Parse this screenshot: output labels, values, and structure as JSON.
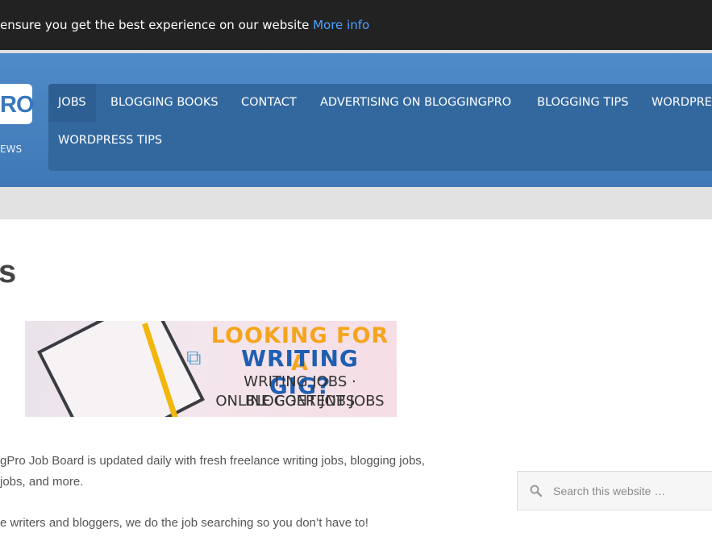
{
  "cookie_bar": {
    "text": "ensure you get the best experience on our website",
    "link": "More info"
  },
  "logo": {
    "text": "RO",
    "tagline": "EWS"
  },
  "nav": {
    "items": [
      {
        "label": "JOBS",
        "active": true
      },
      {
        "label": "BLOGGING BOOKS"
      },
      {
        "label": "CONTACT"
      },
      {
        "label": "ADVERTISING ON BLOGGINGPRO"
      },
      {
        "label": "BLOGGING TIPS"
      },
      {
        "label": "WORDPRE"
      },
      {
        "label": "WORDPRESS TIPS"
      }
    ]
  },
  "page": {
    "title": "s"
  },
  "banner": {
    "line1": "LOOKING FOR A",
    "line2": "WRITING GIG?",
    "line3": "WRITING JOBS · BLOGGER JOBS",
    "line4": "ONLINE CONTENT JOBS"
  },
  "content": {
    "para1_line1": "gPro Job Board is updated daily with fresh freelance writing jobs, blogging jobs,",
    "para1_line2": "jobs, and more.",
    "para2": "e writers and bloggers, we do the job searching so you don’t have to!"
  },
  "search": {
    "placeholder": "Search this website …"
  },
  "colors": {
    "header_blue": "#4a86c5",
    "nav_blue": "#33689f",
    "cookie_bg": "#222222",
    "link_blue": "#4aa3ff",
    "banner_orange": "#f5a51d",
    "banner_blue": "#1f5fb2"
  }
}
